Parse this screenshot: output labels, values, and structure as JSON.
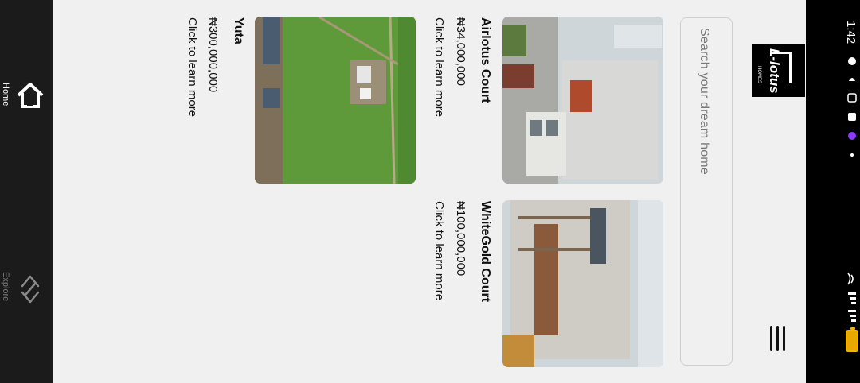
{
  "status_bar": {
    "time": "1:42"
  },
  "header": {
    "logo_text": "L-lotus",
    "logo_subtext": "HOMES",
    "search_placeholder": "Search your dream home"
  },
  "properties": [
    {
      "title": "Airlotus Court",
      "price": "₦34,000,000",
      "link": "Click to learn more"
    },
    {
      "title": "WhiteGold Court",
      "price": "₦100,000,000",
      "link": "Click to learn more"
    },
    {
      "title": "Yuta",
      "price": "₦300,000,000",
      "link": "Click to learn more"
    }
  ],
  "nav": {
    "home_label": "Home",
    "explore_label": "Explore"
  },
  "colors": {
    "nav_bg": "#1b1b1b",
    "accent_battery": "#f2b600"
  },
  "icons": [
    "menu-icon",
    "search-icon",
    "home-icon",
    "code-icon",
    "battery-icon",
    "wifi-icon",
    "signal-icon"
  ]
}
